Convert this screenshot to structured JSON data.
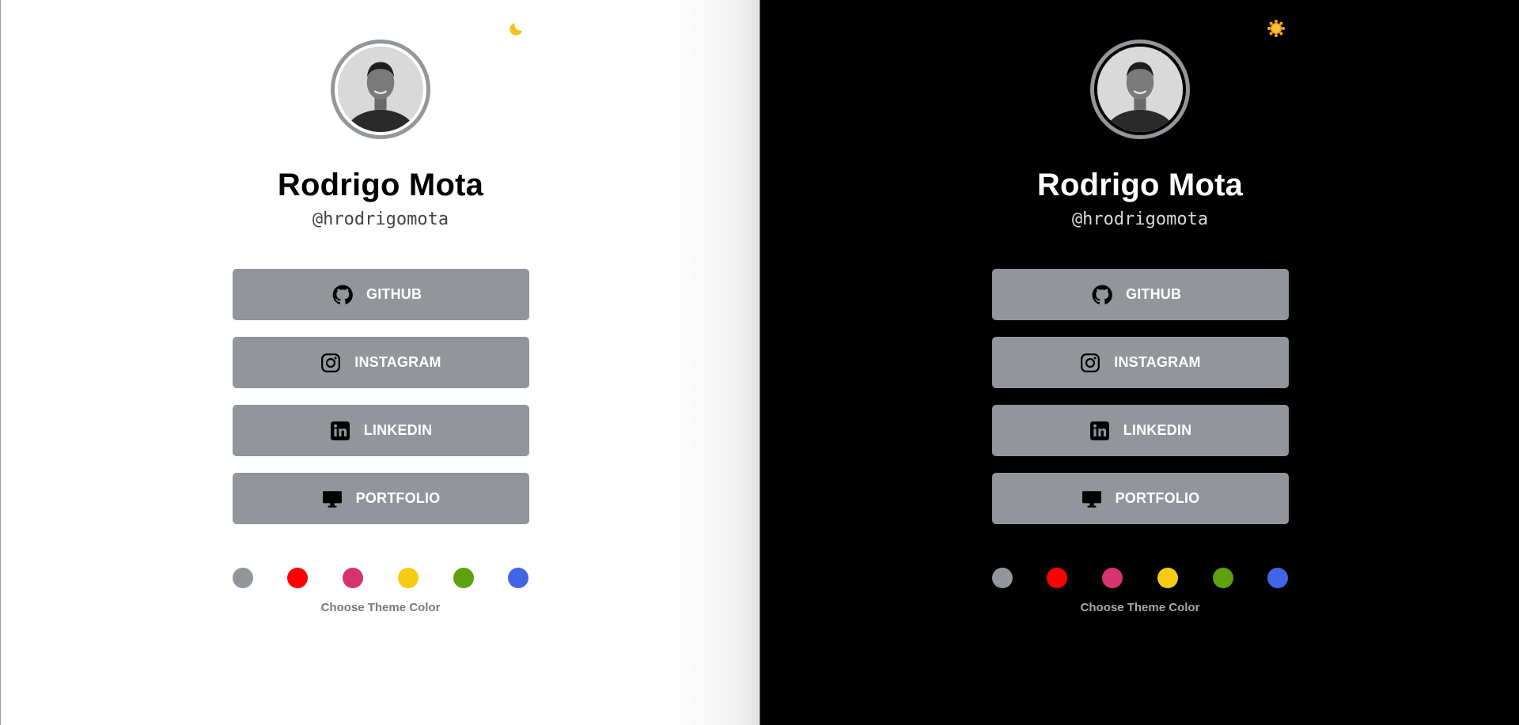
{
  "panels": [
    {
      "theme": "light",
      "toggle_icon": "moon-icon",
      "profile": {
        "name": "Rodrigo Mota",
        "handle": "@hrodrigomota"
      },
      "links": [
        {
          "label": "GITHUB",
          "icon": "github-icon"
        },
        {
          "label": "INSTAGRAM",
          "icon": "instagram-icon"
        },
        {
          "label": "LINKEDIN",
          "icon": "linkedin-icon"
        },
        {
          "label": "PORTFOLIO",
          "icon": "monitor-icon"
        }
      ],
      "theme_colors": [
        "#929599",
        "#ff0000",
        "#d63370",
        "#f5cc13",
        "#5ea10e",
        "#4264e6"
      ],
      "theme_caption": "Choose Theme Color"
    },
    {
      "theme": "dark",
      "toggle_icon": "sun-icon",
      "profile": {
        "name": "Rodrigo Mota",
        "handle": "@hrodrigomota"
      },
      "links": [
        {
          "label": "GITHUB",
          "icon": "github-icon"
        },
        {
          "label": "INSTAGRAM",
          "icon": "instagram-icon"
        },
        {
          "label": "LINKEDIN",
          "icon": "linkedin-icon"
        },
        {
          "label": "PORTFOLIO",
          "icon": "monitor-icon"
        }
      ],
      "theme_colors": [
        "#929599",
        "#ff0000",
        "#d63370",
        "#f5cc13",
        "#5ea10e",
        "#4264e6"
      ],
      "theme_caption": "Choose Theme Color"
    }
  ],
  "colors": {
    "button_bg": "#929599",
    "button_text": "#ffffff",
    "avatar_ring": "#94979a",
    "moon": "#f0c21b",
    "sun": "#f7a21b"
  }
}
